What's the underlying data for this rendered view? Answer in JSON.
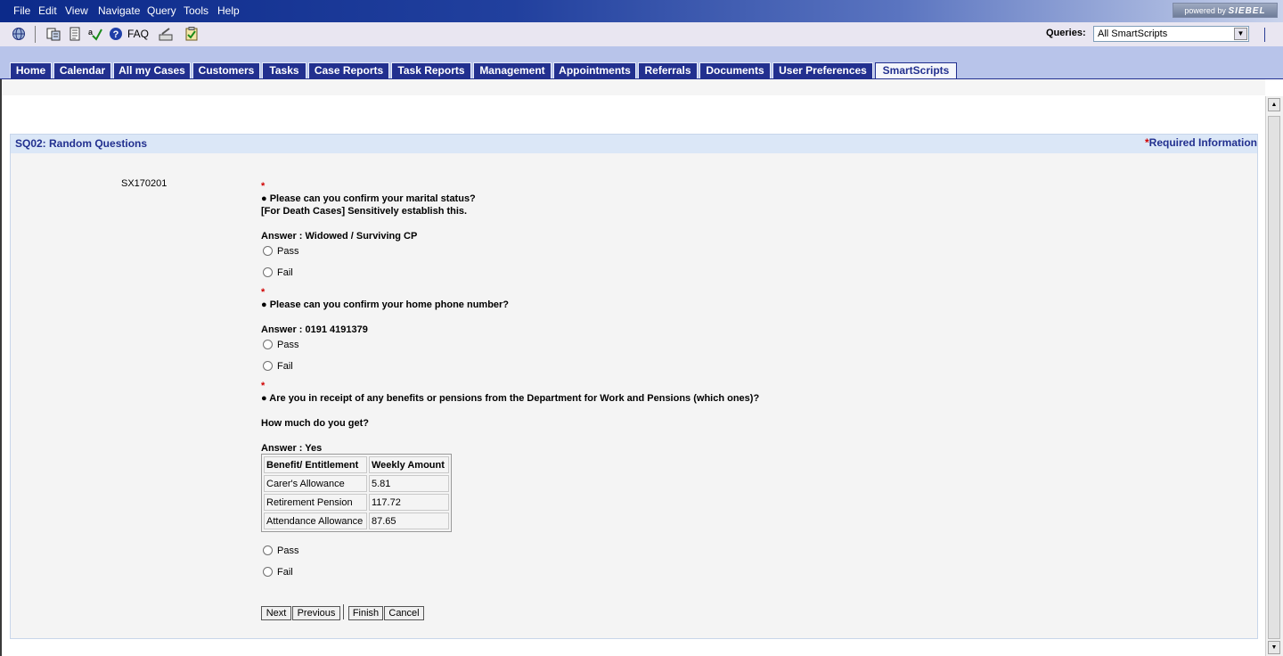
{
  "menu": {
    "items": [
      "File",
      "Edit",
      "View",
      "Navigate",
      "Query",
      "Tools",
      "Help"
    ],
    "brand": {
      "prefix": "powered by",
      "name": "SIEBEL"
    }
  },
  "toolbar": {
    "faq_label": "FAQ",
    "queries_label": "Queries:",
    "queries_value": "All SmartScripts",
    "icons": [
      "globe-icon",
      "sync-icon",
      "document-icon",
      "spellcheck-icon",
      "help-icon",
      "edit-icon",
      "clipboard-icon"
    ]
  },
  "tabs": [
    {
      "label": "Home"
    },
    {
      "label": "Calendar"
    },
    {
      "label": "All my Cases"
    },
    {
      "label": "Customers"
    },
    {
      "label": "Tasks"
    },
    {
      "label": "Case Reports"
    },
    {
      "label": "Task Reports"
    },
    {
      "label": "Management"
    },
    {
      "label": "Appointments"
    },
    {
      "label": "Referrals"
    },
    {
      "label": "Documents"
    },
    {
      "label": "User Preferences"
    },
    {
      "label": "SmartScripts",
      "active": true
    }
  ],
  "panel": {
    "title": "SQ02: Random Questions",
    "required_star": "*",
    "required_label": "Required Information"
  },
  "script": {
    "ref_code": "SX170201",
    "required_marker": "*",
    "q1": {
      "question": "●  Please can you confirm your marital status?",
      "note": "[For Death Cases] Sensitively establish this.",
      "answer": "Answer : Widowed / Surviving CP"
    },
    "q2": {
      "question": "●  Please can you confirm your home phone number?",
      "answer": "Answer :   0191 4191379"
    },
    "q3": {
      "question": "●  Are you in receipt of any benefits or pensions from the Department for Work and Pensions (which ones)?",
      "note": "How much do you get?",
      "answer": "Answer : Yes"
    },
    "pass_label": "Pass",
    "fail_label": "Fail",
    "table": {
      "headers": [
        "Benefit/ Entitlement",
        "Weekly Amount"
      ],
      "rows": [
        [
          "Carer's Allowance",
          "5.81"
        ],
        [
          "Retirement Pension",
          "117.72"
        ],
        [
          "Attendance Allowance",
          "87.65"
        ]
      ]
    },
    "buttons": {
      "next": "Next",
      "previous": "Previous",
      "finish": "Finish",
      "cancel": "Cancel"
    }
  }
}
